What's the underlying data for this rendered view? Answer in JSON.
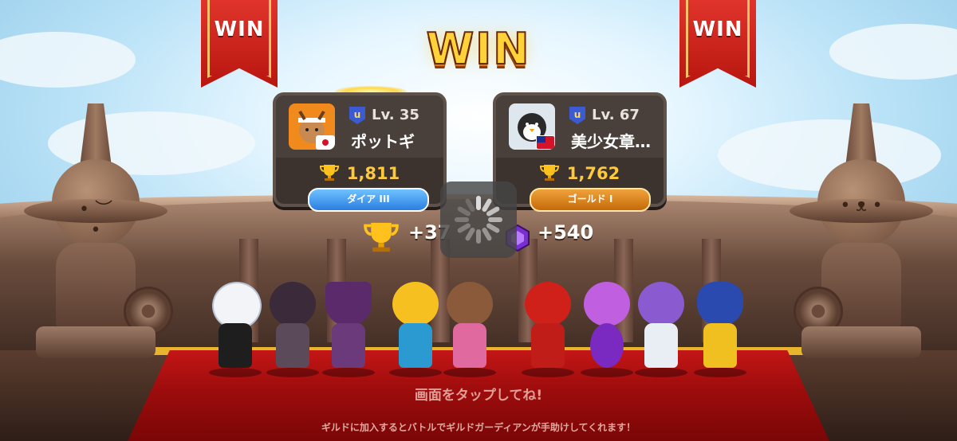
{
  "banners": {
    "left_label": "WIN",
    "right_label": "WIN"
  },
  "result_title": "WIN",
  "players": [
    {
      "level": "Lv. 35",
      "name": "ポットギ",
      "trophies": "1,811",
      "rank": "ダイア III",
      "flag": "japan-flag"
    },
    {
      "level": "Lv. 67",
      "name": "美少女章…",
      "trophies": "1,762",
      "rank": "ゴールド I",
      "flag": "taiwan-flag"
    }
  ],
  "rewards": {
    "trophy_gain": "+37",
    "gem_gain": "+540"
  },
  "prompt": {
    "tap": "画面をタップしてね!",
    "hint": "ギルドに加入するとバトルでギルドガーディアンが手助けしてくれます！"
  },
  "colors": {
    "win_gold": "#ffd23a",
    "banner_red": "#c81f16",
    "carpet_red": "#b01010",
    "rank_diamond": "#3d92ea",
    "rank_gold": "#e08a1e"
  }
}
